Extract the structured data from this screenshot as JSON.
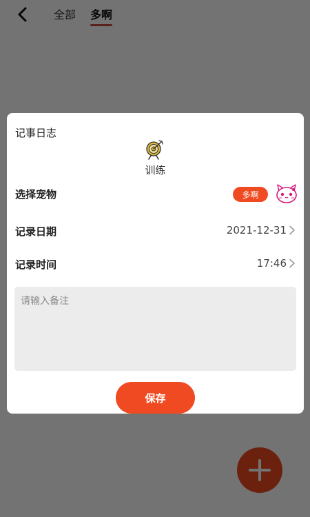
{
  "header": {
    "tabs": [
      {
        "label": "全部",
        "active": false
      },
      {
        "label": "多啊",
        "active": true
      }
    ],
    "back_icon": "chevron-left-icon"
  },
  "dialog": {
    "title": "记事日志",
    "event_type": {
      "icon": "target-icon",
      "label": "训练"
    },
    "pet": {
      "label": "选择宠物",
      "selected": "多啊",
      "avatar_icon": "cat-avatar-icon"
    },
    "date": {
      "label": "记录日期",
      "value": "2021-12-31"
    },
    "time": {
      "label": "记录时间",
      "value": "17:46"
    },
    "note": {
      "placeholder": "请输入备注",
      "value": ""
    },
    "save_label": "保存"
  },
  "fab": {
    "icon": "plus-icon"
  },
  "colors": {
    "accent": "#f04a22",
    "tab_underline": "#c94a3c",
    "note_bg": "#ececec",
    "overlay": "rgba(0,0,0,0.55)"
  }
}
